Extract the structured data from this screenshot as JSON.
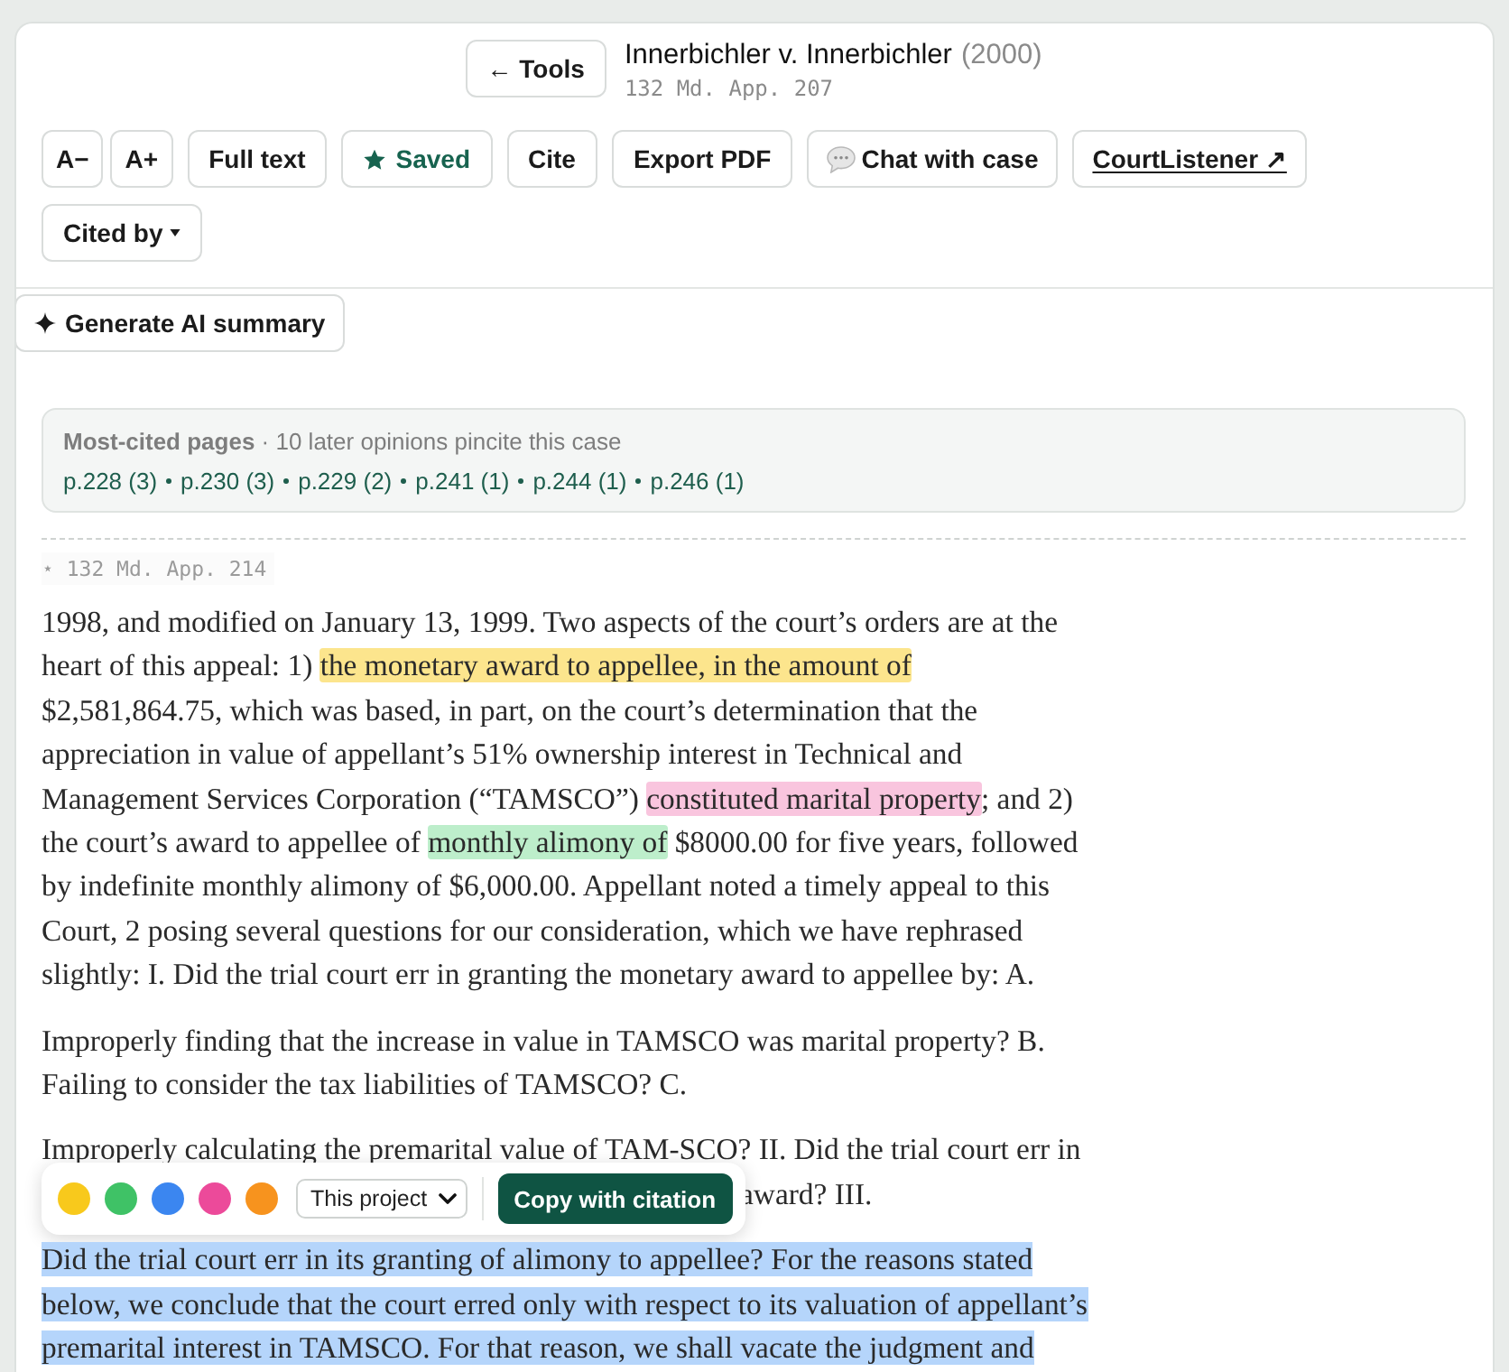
{
  "header": {
    "back_button": "← Tools",
    "title": "Innerbichler v. Innerbichler",
    "year": "(2000)",
    "citation": "132 Md. App. 207"
  },
  "toolbar": [
    {
      "kind": "size",
      "label": "A−"
    },
    {
      "kind": "size",
      "label": "A+"
    },
    {
      "kind": "button",
      "label": "Full text"
    },
    {
      "kind": "toggle",
      "label": "Saved",
      "on": true
    },
    {
      "kind": "button",
      "label": "Cite"
    },
    {
      "kind": "button",
      "label": "Export PDF"
    },
    {
      "kind": "chat",
      "label": "Chat with case"
    },
    {
      "kind": "link",
      "label": "CourtListener ↗"
    },
    {
      "kind": "dropdown",
      "label": "Cited by"
    }
  ],
  "summary_button": "Generate AI summary",
  "most_cited": {
    "heading": "**Most-cited pages** · 10 later opinions pincite this case",
    "pages": [
      "p.228 (3)",
      "p.230 (3)",
      "p.229 (2)",
      "p.241 (1)",
      "p.244 (1)",
      "p.246 (1)"
    ]
  },
  "page_marker": "⋆ 132 Md. App. 214",
  "paragraphs": [
    {
      "selected": false,
      "segments": [
        {
          "text": "1998, and modified on January 13, 1999. Two aspects of the court’s orders are at the heart of this appeal: 1) "
        },
        {
          "text": "the monetary award to appellee, in the amount of",
          "color": "#fce58d"
        },
        {
          "text": " $2,581,864.75, which was based, in part, on the court’s determination that the appreciation in value of appellant’s 51% ownership interest in Technical and Management Services Corporation (“TAMSCO”) "
        },
        {
          "text": "constituted marital property",
          "color": "#f9c5de"
        },
        {
          "text": "; and 2) the court’s award to appellee of "
        },
        {
          "text": "monthly alimony of",
          "color": "#bdeecb"
        },
        {
          "text": " $8000.00 for five years, followed by indefinite monthly alimony of $6,000.00. Appellant noted a timely appeal to this Court, 2 posing several questions for our consideration, which we have rephrased slightly: I. Did the trial court err in granting the monetary award to appellee by: A."
        }
      ]
    },
    {
      "selected": false,
      "segments": [
        {
          "text": "Improperly finding that the increase in value in TAMSCO was marital property? B. Failing to consider the tax liabilities of TAMSCO? C."
        }
      ]
    },
    {
      "selected": false,
      "segments": [
        {
          "text": "Improperly calculating the premarital value of TAM-SCO? II. Did the trial court err in"
        }
      ],
      "text_after_toolbar": "award? III."
    },
    {
      "selected": true,
      "segments": [
        {
          "text": "Did the trial court err in its granting of alimony to appellee? For the reasons stated below, we conclude that the court erred only with respect to its valuation of appellant’s premarital interest in TAMSCO. For that reason, we shall vacate the judgment and"
        }
      ]
    }
  ],
  "highlight_toolbar": {
    "swatches": [
      {
        "color": "#f8c91c"
      },
      {
        "color": "#3fc266"
      },
      {
        "color": "#3b86f0"
      },
      {
        "color": "#ec4a9a"
      },
      {
        "color": "#f7931e"
      }
    ],
    "scope_select": {
      "value": "This project"
    },
    "copy_button": "Copy with citation"
  }
}
